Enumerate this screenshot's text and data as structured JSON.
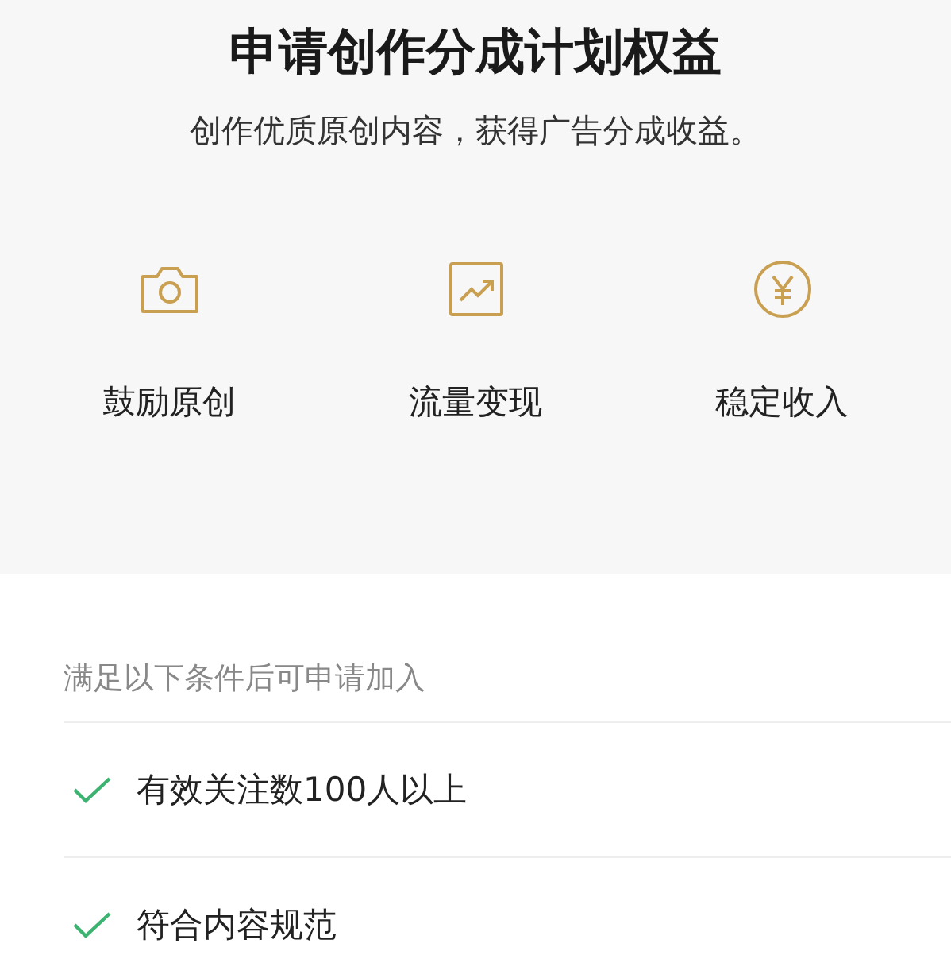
{
  "header": {
    "title": "申请创作分成计划权益",
    "subtitle": "创作优质原创内容，获得广告分成收益。"
  },
  "benefits": [
    {
      "kind": "camera",
      "label": "鼓励原创"
    },
    {
      "kind": "chart",
      "label": "流量变现"
    },
    {
      "kind": "yen",
      "label": "稳定收入"
    }
  ],
  "requirements": {
    "heading": "满足以下条件后可申请加入",
    "items": [
      {
        "text": "有效关注数100人以上",
        "met": true
      },
      {
        "text": "符合内容规范",
        "met": true
      }
    ]
  }
}
